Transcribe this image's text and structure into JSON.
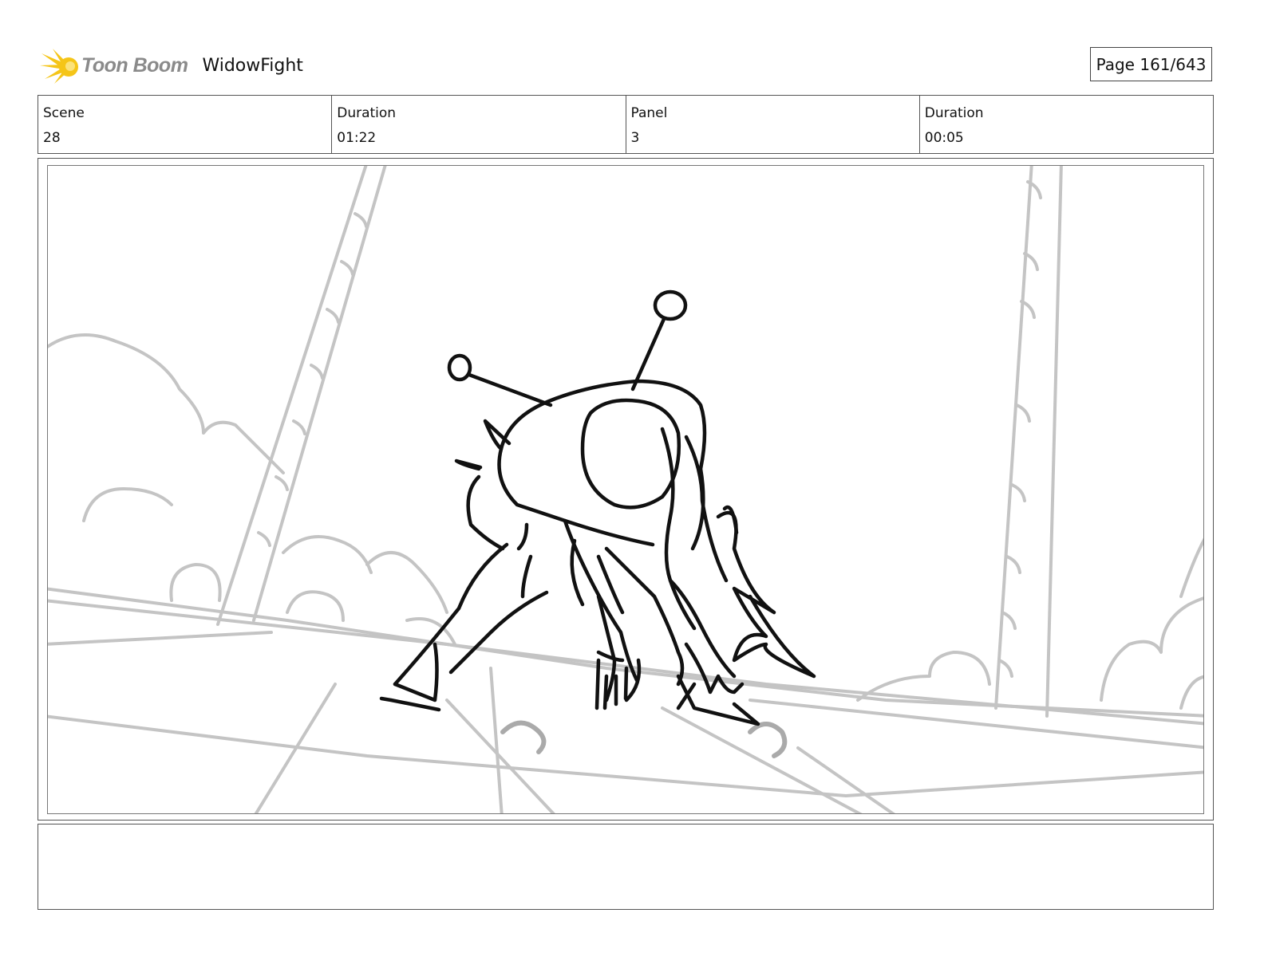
{
  "header": {
    "logo_text": "Toon Boom",
    "project_title": "WidowFight",
    "page_label": "Page 161/643"
  },
  "info": [
    {
      "label": "Scene",
      "value": "28"
    },
    {
      "label": "Duration",
      "value": "01:22"
    },
    {
      "label": "Panel",
      "value": "3"
    },
    {
      "label": "Duration",
      "value": "00:05"
    }
  ],
  "notes": {
    "text": ""
  },
  "colors": {
    "logo_burst": "#f5c518",
    "logo_text": "#8a8a8a",
    "sketch_ink": "#111111",
    "background_sketch": "#c4c4c4"
  }
}
